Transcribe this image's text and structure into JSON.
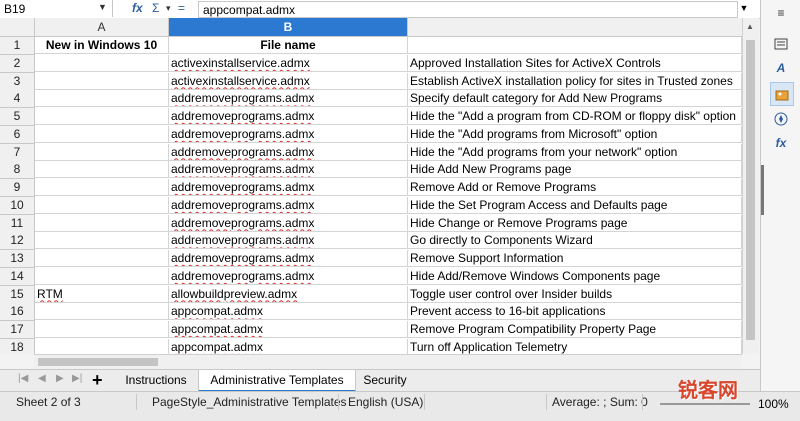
{
  "formula_bar": {
    "cell_ref": "B19",
    "fx_symbol": "fx",
    "sum_symbol": "Σ",
    "dropdown_symbol": "▾",
    "equals_symbol": "=",
    "content": "appcompat.admx"
  },
  "columns": [
    "A",
    "B"
  ],
  "rows": [
    {
      "num": "1",
      "a": "New in Windows 10",
      "b": "File name",
      "c": ""
    },
    {
      "num": "2",
      "a": "",
      "b": "activexinstallservice.admx",
      "c": "Approved Installation Sites for ActiveX Controls"
    },
    {
      "num": "3",
      "a": "",
      "b": "activexinstallservice.admx",
      "c": "Establish ActiveX installation policy for sites in Trusted zones"
    },
    {
      "num": "4",
      "a": "",
      "b": "addremoveprograms.admx",
      "c": "Specify default category for Add New Programs"
    },
    {
      "num": "5",
      "a": "",
      "b": "addremoveprograms.admx",
      "c": "Hide the \"Add a program from CD-ROM or floppy disk\" option"
    },
    {
      "num": "6",
      "a": "",
      "b": "addremoveprograms.admx",
      "c": "Hide the \"Add programs from Microsoft\" option"
    },
    {
      "num": "7",
      "a": "",
      "b": "addremoveprograms.admx",
      "c": "Hide the \"Add programs from your network\" option"
    },
    {
      "num": "8",
      "a": "",
      "b": "addremoveprograms.admx",
      "c": "Hide Add New Programs page"
    },
    {
      "num": "9",
      "a": "",
      "b": "addremoveprograms.admx",
      "c": "Remove Add or Remove Programs"
    },
    {
      "num": "10",
      "a": "",
      "b": "addremoveprograms.admx",
      "c": "Hide the Set Program Access and Defaults page"
    },
    {
      "num": "11",
      "a": "",
      "b": "addremoveprograms.admx",
      "c": "Hide Change or Remove Programs page"
    },
    {
      "num": "12",
      "a": "",
      "b": "addremoveprograms.admx",
      "c": "Go directly to Components Wizard"
    },
    {
      "num": "13",
      "a": "",
      "b": "addremoveprograms.admx",
      "c": "Remove Support Information"
    },
    {
      "num": "14",
      "a": "",
      "b": "addremoveprograms.admx",
      "c": "Hide Add/Remove Windows Components page"
    },
    {
      "num": "15",
      "a": "RTM",
      "b": "allowbuildpreview.admx",
      "c": "Toggle user control over Insider builds"
    },
    {
      "num": "16",
      "a": "",
      "b": "appcompat.admx",
      "c": "Prevent access to 16-bit applications"
    },
    {
      "num": "17",
      "a": "",
      "b": "appcompat.admx",
      "c": "Remove Program Compatibility Property Page"
    },
    {
      "num": "18",
      "a": "",
      "b": "appcompat.admx",
      "c": "Turn off Application Telemetry"
    }
  ],
  "sheet_tabs": [
    "Instructions",
    "Administrative Templates",
    "Security"
  ],
  "active_tab": "Administrative Templates",
  "add_sheet_symbol": "+",
  "status": {
    "sheet": "Sheet 2 of 3",
    "page_style": "PageStyle_Administrative Templates",
    "language": "English (USA)",
    "summary": "Average: ; Sum: 0",
    "zoom": "100%"
  },
  "sidebar_icons": [
    "properties-icon",
    "styles-icon",
    "gallery-icon",
    "navigator-icon",
    "functions-icon"
  ],
  "sidebar_fx": "fx",
  "watermark": "锐客网",
  "accent_color": "#2b79d1"
}
